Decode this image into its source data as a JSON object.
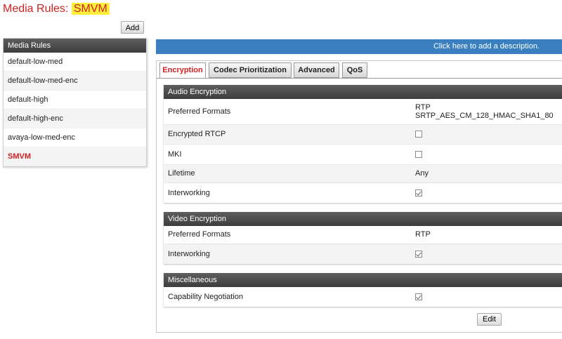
{
  "page_title": {
    "prefix": "Media Rules:",
    "name": "SMVM"
  },
  "add_label": "Add",
  "sidebar": {
    "header": "Media Rules",
    "items": [
      {
        "label": "default-low-med"
      },
      {
        "label": "default-low-med-enc"
      },
      {
        "label": "default-high"
      },
      {
        "label": "default-high-enc"
      },
      {
        "label": "avaya-low-med-enc"
      },
      {
        "label": "SMVM",
        "selected": true
      }
    ]
  },
  "description_bar": "Click here to add a description.",
  "tabs": [
    {
      "label": "Encryption",
      "active": true
    },
    {
      "label": "Codec Prioritization"
    },
    {
      "label": "Advanced"
    },
    {
      "label": "QoS"
    }
  ],
  "audio": {
    "header": "Audio Encryption",
    "preferred_formats_label": "Preferred Formats",
    "preferred_formats_1": "RTP",
    "preferred_formats_2": "SRTP_AES_CM_128_HMAC_SHA1_80",
    "encrypted_rtcp_label": "Encrypted RTCP",
    "encrypted_rtcp_checked": false,
    "mki_label": "MKI",
    "mki_checked": false,
    "lifetime_label": "Lifetime",
    "lifetime_value": "Any",
    "interworking_label": "Interworking",
    "interworking_checked": true
  },
  "video": {
    "header": "Video Encryption",
    "preferred_formats_label": "Preferred Formats",
    "preferred_formats_value": "RTP",
    "interworking_label": "Interworking",
    "interworking_checked": true
  },
  "misc": {
    "header": "Miscellaneous",
    "capability_negotiation_label": "Capability Negotiation",
    "capability_negotiation_checked": true
  },
  "edit_label": "Edit",
  "colors": {
    "accent_red": "#d02020",
    "highlight_yellow": "#ffef3a",
    "bar_blue": "#3a80c0"
  }
}
